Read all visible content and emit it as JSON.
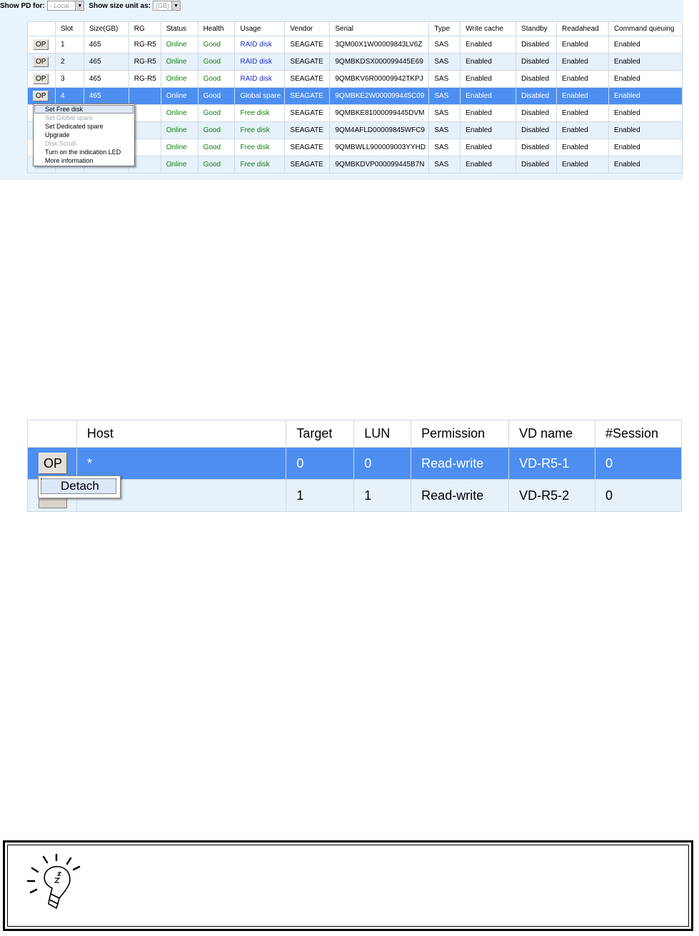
{
  "pd_panel": {
    "show_pd_label": "Show PD for:",
    "show_pd_value": "- Local -",
    "size_unit_label": "Show size unit as:",
    "size_unit_value": "(GB)",
    "columns": [
      "",
      "Slot",
      "Size(GB)",
      "RG",
      "Status",
      "Health",
      "Usage",
      "Vendor",
      "Serial",
      "Type",
      "Write cache",
      "Standby",
      "Readahead",
      "Command queuing"
    ],
    "rows": [
      {
        "op": "OP",
        "slot": "1",
        "size": "465",
        "rg": "RG-R5",
        "status": "Online",
        "health": "Good",
        "usage": "RAID disk",
        "vendor": "SEAGATE",
        "serial": "3QM00X1W00009843LV6Z",
        "type": "SAS",
        "write_cache": "Enabled",
        "standby": "Disabled",
        "readahead": "Enabled",
        "cmd_queuing": "Enabled"
      },
      {
        "op": "OP",
        "slot": "2",
        "size": "465",
        "rg": "RG-R5",
        "status": "Online",
        "health": "Good",
        "usage": "RAID disk",
        "vendor": "SEAGATE",
        "serial": "9QMBKDSX000099445E69",
        "type": "SAS",
        "write_cache": "Enabled",
        "standby": "Disabled",
        "readahead": "Enabled",
        "cmd_queuing": "Enabled"
      },
      {
        "op": "OP",
        "slot": "3",
        "size": "465",
        "rg": "RG-R5",
        "status": "Online",
        "health": "Good",
        "usage": "RAID disk",
        "vendor": "SEAGATE",
        "serial": "9QMBKV6R00009942TKPJ",
        "type": "SAS",
        "write_cache": "Enabled",
        "standby": "Disabled",
        "readahead": "Enabled",
        "cmd_queuing": "Enabled"
      },
      {
        "op": "OP",
        "slot": "4",
        "size": "465",
        "rg": "",
        "status": "Online",
        "health": "Good",
        "usage": "Global spare",
        "vendor": "SEAGATE",
        "serial": "9QMBKE2W000099445C09",
        "type": "SAS",
        "write_cache": "Enabled",
        "standby": "Disabled",
        "readahead": "Enabled",
        "cmd_queuing": "Enabled"
      },
      {
        "op": "",
        "slot": "",
        "size": "",
        "rg": "",
        "status": "Online",
        "health": "Good",
        "usage": "Free disk",
        "vendor": "SEAGATE",
        "serial": "9QMBKE81000099445DVM",
        "type": "SAS",
        "write_cache": "Enabled",
        "standby": "Disabled",
        "readahead": "Enabled",
        "cmd_queuing": "Enabled"
      },
      {
        "op": "",
        "slot": "",
        "size": "",
        "rg": "",
        "status": "Online",
        "health": "Good",
        "usage": "Free disk",
        "vendor": "SEAGATE",
        "serial": "9QM4AFLD00009845WFC9",
        "type": "SAS",
        "write_cache": "Enabled",
        "standby": "Disabled",
        "readahead": "Enabled",
        "cmd_queuing": "Enabled"
      },
      {
        "op": "",
        "slot": "",
        "size": "",
        "rg": "",
        "status": "Online",
        "health": "Good",
        "usage": "Free disk",
        "vendor": "SEAGATE",
        "serial": "9QMBWLL900009003YYHD",
        "type": "SAS",
        "write_cache": "Enabled",
        "standby": "Disabled",
        "readahead": "Enabled",
        "cmd_queuing": "Enabled"
      },
      {
        "op": "",
        "slot": "",
        "size": "",
        "rg": "",
        "status": "Online",
        "health": "Good",
        "usage": "Free disk",
        "vendor": "SEAGATE",
        "serial": "9QMBKDVP000099445B7N",
        "type": "SAS",
        "write_cache": "Enabled",
        "standby": "Disabled",
        "readahead": "Enabled",
        "cmd_queuing": "Enabled"
      }
    ],
    "menu": [
      "Set Free disk",
      "Set Global spare",
      "Set Dedicated spare",
      "Upgrade",
      "Disk Scrub",
      "Turn on the indication LED",
      "More information"
    ]
  },
  "host_panel": {
    "columns": [
      "",
      "Host",
      "Target",
      "LUN",
      "Permission",
      "VD name",
      "#Session"
    ],
    "rows": [
      {
        "host": "*",
        "target": "0",
        "lun": "0",
        "permission": "Read-write",
        "vd_name": "VD-R5-1",
        "session": "0"
      },
      {
        "host": "",
        "target": "1",
        "lun": "1",
        "permission": "Read-write",
        "vd_name": "VD-R5-2",
        "session": "0"
      }
    ],
    "op_label": "OP",
    "menu_item": "Detach"
  },
  "colors": {
    "selected_row": "#4d8ef0",
    "alt_row": "#e6f1fa",
    "green_text": "#108010",
    "blue_text": "#1a2ccc"
  }
}
